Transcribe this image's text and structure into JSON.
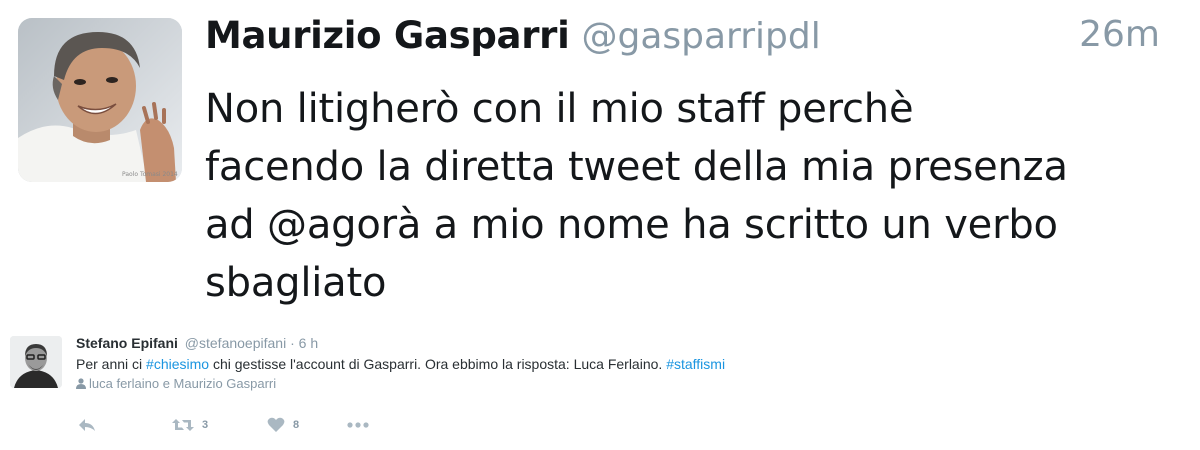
{
  "quoted_tweet": {
    "name": "Maurizio Gasparri",
    "handle": "@gasparripdl",
    "time": "26m",
    "text_lines": [
      "Non litigherò con il mio staff perchè",
      "facendo la diretta tweet della mia presenza",
      "ad @agorà a mio nome ha scritto un verbo",
      "sbagliato"
    ],
    "avatar_watermark": "Paolo Tomasi 2014"
  },
  "tweet": {
    "name": "Stefano Epifani",
    "handle": "@stefanoepifani",
    "separator": "·",
    "time": "6 h",
    "text": {
      "part1": "Per anni ci ",
      "hashtag1": "#chiesimo",
      "part2": " chi gestisse l'account di Gasparri. Ora ebbimo la risposta: Luca Ferlaino. ",
      "hashtag2": "#staffismi"
    },
    "context": "luca ferlaino e Maurizio Gasparri",
    "retweet_count": "3",
    "like_count": "8"
  },
  "colors": {
    "link": "#1b95e0",
    "secondary": "#8899a6",
    "action_icon": "#aab8c2",
    "text": "#14171a"
  },
  "icons": {
    "reply": "reply-icon",
    "retweet": "retweet-icon",
    "like": "heart-icon",
    "more": "more-icon",
    "person": "person-icon"
  }
}
